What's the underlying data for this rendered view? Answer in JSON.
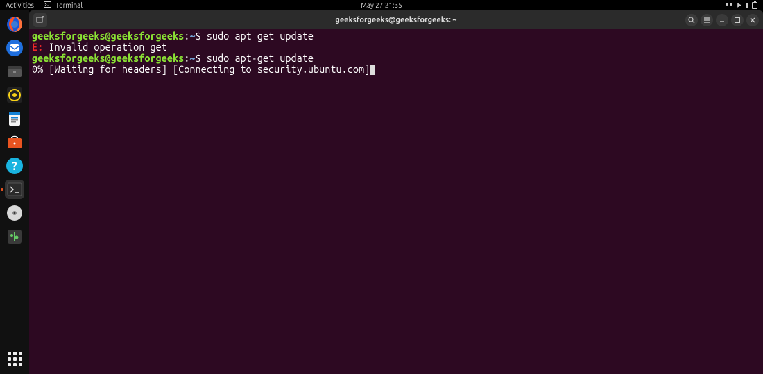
{
  "topbar": {
    "activities": "Activities",
    "app_name": "Terminal",
    "datetime": "May 27  21:35"
  },
  "dock": {
    "items": [
      {
        "name": "firefox-icon"
      },
      {
        "name": "thunderbird-icon"
      },
      {
        "name": "files-icon"
      },
      {
        "name": "rhythmbox-icon"
      },
      {
        "name": "writer-icon"
      },
      {
        "name": "software-icon"
      },
      {
        "name": "help-icon"
      },
      {
        "name": "terminal-icon"
      },
      {
        "name": "disc-icon"
      },
      {
        "name": "trash-icon"
      }
    ]
  },
  "window": {
    "title": "geeksforgeeks@geeksforgeeks: ~"
  },
  "terminal": {
    "prompt_user": "geeksforgeeks@geeksforgeeks",
    "prompt_path": "~",
    "lines": [
      {
        "type": "prompt",
        "cmd": "sudo apt get update"
      },
      {
        "type": "error",
        "prefix": "E:",
        "msg": " Invalid operation get"
      },
      {
        "type": "prompt",
        "cmd": "sudo apt-get update"
      },
      {
        "type": "output",
        "msg": "0% [Waiting for headers] [Connecting to security.ubuntu.com]",
        "cursor": true
      }
    ]
  }
}
